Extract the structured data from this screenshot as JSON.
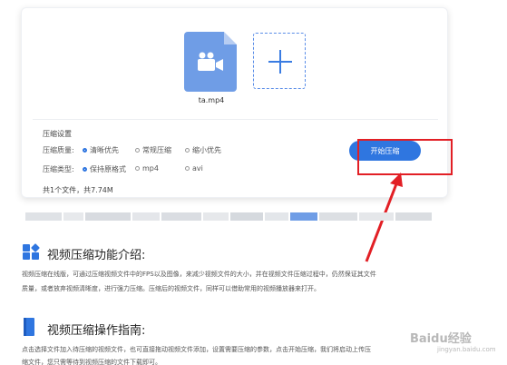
{
  "upload": {
    "file_name": "ta.mp4",
    "file_icon": "video-file-icon",
    "add_icon": "plus-icon"
  },
  "settings": {
    "title": "压缩设置",
    "quality": {
      "label": "压缩质量:",
      "options": [
        "清晰优先",
        "常规压缩",
        "缩小优先"
      ],
      "selected": "清晰优先"
    },
    "type": {
      "label": "压缩类型:",
      "options": [
        "保持原格式",
        "mp4",
        "avi"
      ],
      "selected": "保持原格式"
    },
    "file_count": "共1个文件，共7.74M"
  },
  "start_button": {
    "label": "开始压缩"
  },
  "colors": {
    "accent": "#2f76e0",
    "highlight": "#e21f25",
    "thumb": "#6f9de6"
  },
  "sections": [
    {
      "icon": "apps-grid-icon",
      "title": "视频压缩功能介绍:",
      "lines": [
        "视频压缩在线版，可通过压缩视频文件中的FPS以及图像，来减少视频文件的大小，并在视频文件压缩过程中，仍然保证其文件",
        "质量，或者放弃视频清晰度，进行强力压缩。压缩后的视频文件，同样可以借助常用的视频播放器来打开。"
      ]
    },
    {
      "icon": "book-icon",
      "title": "视频压缩操作指南:",
      "lines": [
        "点击选择文件加入待压缩的视频文件，也可直接拖动视频文件添加，设置需要压缩的参数，点击开始压缩，我们将启动上传压",
        "缩文件，您只需等待到视频压缩的文件下载即可。"
      ]
    }
  ],
  "watermark": {
    "logo": "Baidu经验",
    "sub": "jingyan.baidu.com"
  }
}
